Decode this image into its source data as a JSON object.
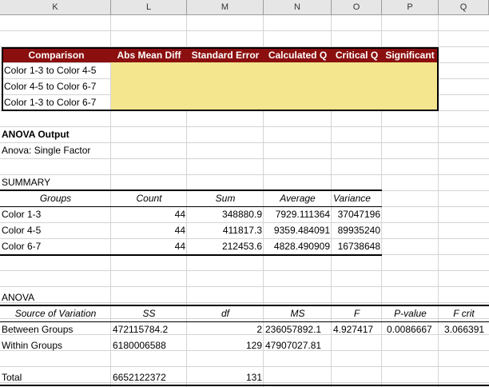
{
  "columns": [
    "K",
    "L",
    "M",
    "N",
    "O",
    "P",
    "Q"
  ],
  "comparison_table": {
    "headers": [
      "Comparison",
      "Abs Mean Diff",
      "Standard Error",
      "Calculated Q",
      "Critical Q",
      "Significant"
    ],
    "rows": [
      "Color 1-3 to Color 4-5",
      "Color 4-5 to Color 6-7",
      "Color 1-3 to Color 6-7"
    ]
  },
  "anova_output": {
    "title": "ANOVA Output",
    "subtitle": "Anova: Single Factor"
  },
  "summary": {
    "title": "SUMMARY",
    "headers": [
      "Groups",
      "Count",
      "Sum",
      "Average",
      "Variance"
    ],
    "rows": [
      [
        "Color 1-3",
        "44",
        "348880.9",
        "7929.111364",
        "37047196"
      ],
      [
        "Color 4-5",
        "44",
        "411817.3",
        "9359.484091",
        "89935240"
      ],
      [
        "Color 6-7",
        "44",
        "212453.6",
        "4828.490909",
        "16738648"
      ]
    ]
  },
  "anova": {
    "title": "ANOVA",
    "headers": [
      "Source of Variation",
      "SS",
      "df",
      "MS",
      "F",
      "P-value",
      "F crit"
    ],
    "between": [
      "Between Groups",
      "472115784.2",
      "2",
      "236057892.1",
      "4.927417",
      "0.0086667",
      "3.066391"
    ],
    "within": [
      "Within Groups",
      "6180006588",
      "129",
      "47907027.81"
    ],
    "total": [
      "Total",
      "6652122372",
      "131"
    ]
  },
  "colors": {
    "header_band": "#8b0f0f",
    "highlight": "#f4e68f",
    "grid": "#d4d4d4"
  }
}
